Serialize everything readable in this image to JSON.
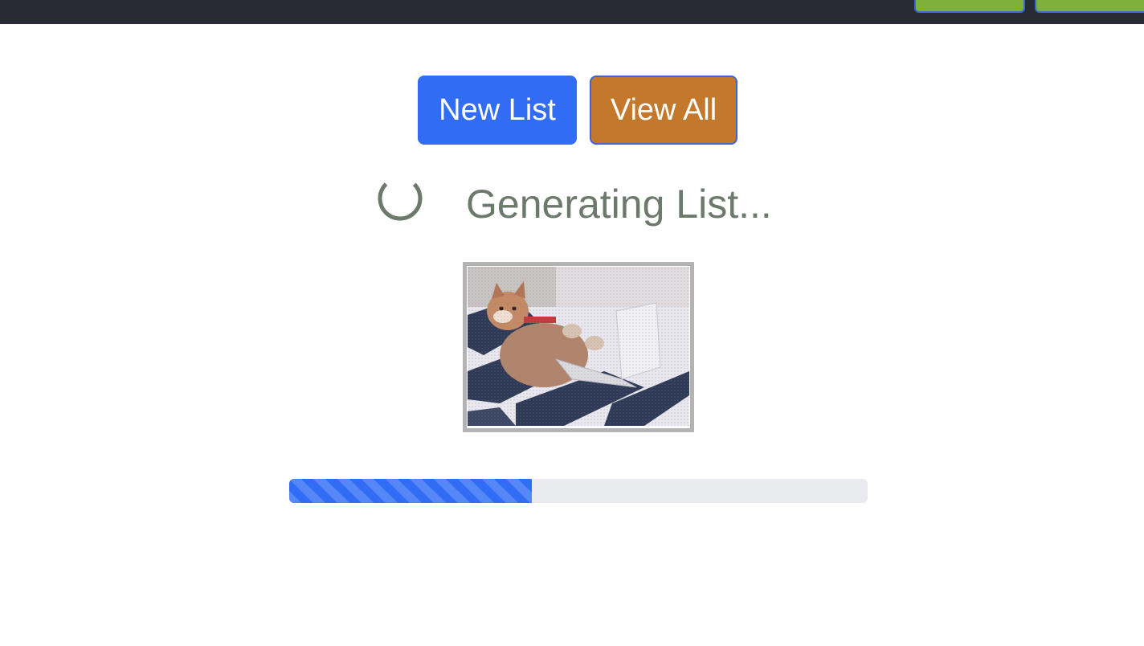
{
  "header": {
    "buttons": [
      "",
      ""
    ]
  },
  "actions": {
    "new_list_label": "New List",
    "view_all_label": "View All"
  },
  "status": {
    "text": "Generating List...",
    "progress_fraction": 0.42
  },
  "image": {
    "icon": "loading-dog-gif"
  },
  "colors": {
    "primary": "#316cf4",
    "secondary": "#c4782b",
    "topbar": "#282b34",
    "top_button": "#7fb03a",
    "status_text": "#6b7a6b"
  }
}
